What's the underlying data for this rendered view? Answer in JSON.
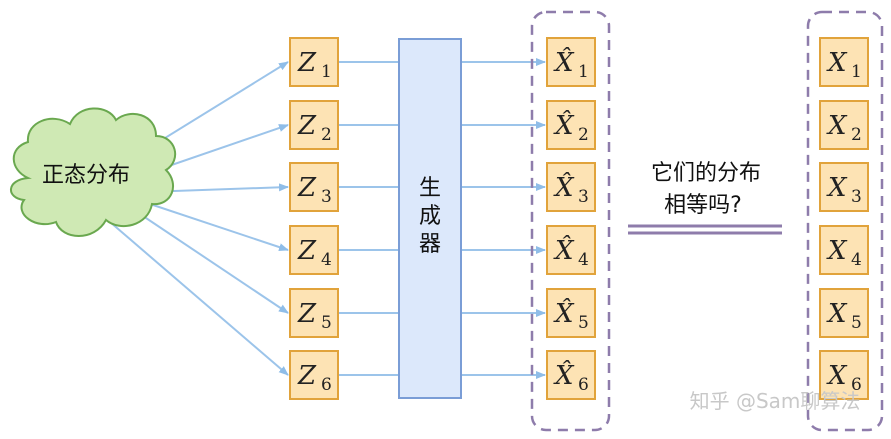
{
  "cloud_label": "正态分布",
  "generator_label": [
    "生",
    "成",
    "器"
  ],
  "latent_boxes": [
    {
      "base": "Z",
      "sub": "1"
    },
    {
      "base": "Z",
      "sub": "2"
    },
    {
      "base": "Z",
      "sub": "3"
    },
    {
      "base": "Z",
      "sub": "4"
    },
    {
      "base": "Z",
      "sub": "5"
    },
    {
      "base": "Z",
      "sub": "6"
    }
  ],
  "generated_boxes": [
    {
      "base": "X̂",
      "sub": "1"
    },
    {
      "base": "X̂",
      "sub": "2"
    },
    {
      "base": "X̂",
      "sub": "3"
    },
    {
      "base": "X̂",
      "sub": "4"
    },
    {
      "base": "X̂",
      "sub": "5"
    },
    {
      "base": "X̂",
      "sub": "6"
    }
  ],
  "real_boxes": [
    {
      "base": "X",
      "sub": "1"
    },
    {
      "base": "X",
      "sub": "2"
    },
    {
      "base": "X",
      "sub": "3"
    },
    {
      "base": "X",
      "sub": "4"
    },
    {
      "base": "X",
      "sub": "5"
    },
    {
      "base": "X",
      "sub": "6"
    }
  ],
  "question_lines": [
    "它们的分布",
    "相等吗?"
  ],
  "watermark": "知乎 @Sam聊算法",
  "colors": {
    "cloud_fill": "#cfe9b4",
    "cloud_stroke": "#6aa84f",
    "box_fill": "#fde3b4",
    "box_stroke": "#e1a33b",
    "generator_fill": "#dce8fb",
    "generator_stroke": "#7a9dd6",
    "arrow": "#9cc4ea",
    "dashed": "#8e7cab",
    "double_line": "#8e7cab"
  }
}
